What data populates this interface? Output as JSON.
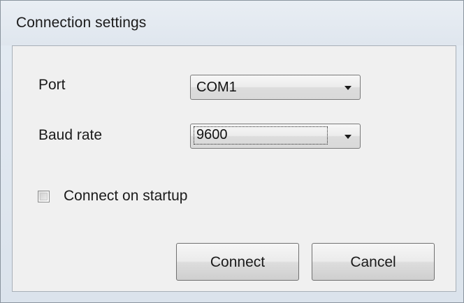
{
  "window": {
    "title": "Connection settings"
  },
  "form": {
    "port": {
      "label": "Port",
      "value": "COM1"
    },
    "baud_rate": {
      "label": "Baud rate",
      "value": "9600"
    },
    "connect_on_startup": {
      "label": "Connect on startup",
      "checked": false
    }
  },
  "buttons": {
    "connect": "Connect",
    "cancel": "Cancel"
  }
}
